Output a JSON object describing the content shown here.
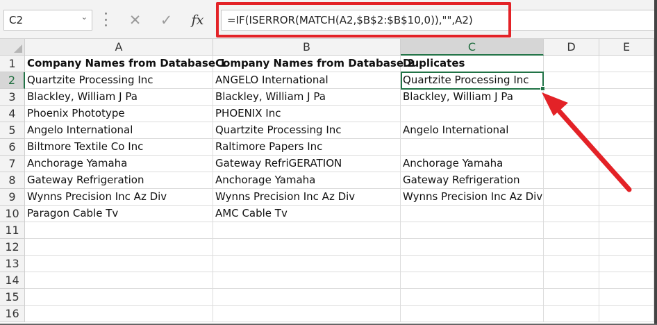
{
  "formula_bar": {
    "name_box": "C2",
    "name_box_dropdown": "⌄",
    "cancel_icon": "✕",
    "enter_icon": "✓",
    "fx_label": "fx",
    "formula": "=IF(ISERROR(MATCH(A2,$B$2:$B$10,0)),\"\",A2)"
  },
  "columns": [
    "A",
    "B",
    "C",
    "D",
    "E"
  ],
  "rows": [
    "1",
    "2",
    "3",
    "4",
    "5",
    "6",
    "7",
    "8",
    "9",
    "10",
    "11",
    "12",
    "13",
    "14",
    "15",
    "16"
  ],
  "cells": {
    "A": [
      "Company Names from Database 1",
      "Quartzite Processing Inc",
      "Blackley, William J Pa",
      "Phoenix Phototype",
      "Angelo International",
      "Biltmore Textile Co Inc",
      "Anchorage Yamaha",
      "Gateway Refrigeration",
      "Wynns Precision Inc Az Div",
      "Paragon Cable Tv"
    ],
    "B": [
      "Company Names from Database 2",
      "ANGELO International",
      "Blackley, William J Pa",
      "PHOENIX Inc",
      "Quartzite Processing Inc",
      "Raltimore Papers Inc",
      "Gateway RefriGERATION",
      "Anchorage Yamaha",
      "Wynns Precision Inc Az Div",
      "AMC Cable Tv"
    ],
    "C": [
      "Duplicates",
      "Quartzite Processing Inc",
      "Blackley, William J Pa",
      "",
      "Angelo International",
      "",
      "Anchorage Yamaha",
      "Gateway Refrigeration",
      "Wynns Precision Inc Az Div",
      ""
    ]
  },
  "selection": {
    "active_cell": "C2",
    "active_column": "C",
    "active_row": "2"
  },
  "colors": {
    "accent_green": "#217346",
    "highlight_red": "#e32227"
  }
}
